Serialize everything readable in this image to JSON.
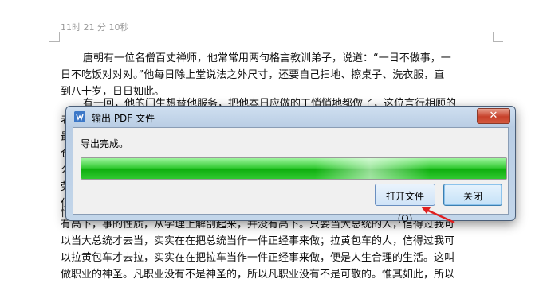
{
  "document": {
    "header_time": "11时 21 分 10秒",
    "paragraph1": [
      "唐朝有一位名僧百丈禅师，他常常用两句格言教训弟子，说道：“一日不做事，一",
      "日不吃饭对对对。”他每日除上堂说法之外尺寸，还要自己扫地、擦桌子、洗衣服，直",
      "到八十岁，日日如此。"
    ],
    "paragraph2_line1": "有一回，他的门生想替他服务，把他本日应做的工悄悄地都做了，这位言行相顾的",
    "paragraph2_frags": [
      "老",
      "最",
      "仓",
      "么",
      "劳",
      "但",
      "惜"
    ],
    "paragraph3": [
      "有高下，事的性质，从学理上解剖起来，并没有高下。只要当大总统的人，信得过我可",
      "以当大总统才去当，实实在在把总统当作一件正经事来做；拉黄包车的人，信得过我可",
      "以拉黄包车才去拉，实实在在把拉车当作一件正经事来做，便是人生合理的生活。这叫",
      "做职业的神圣。凡职业没有不是神圣的，所以凡职业没有不是可敬的。惟其如此，所以"
    ]
  },
  "dialog": {
    "title": "输出 PDF 文件",
    "close_symbol": "✕",
    "status": "导出完成。",
    "progress_percent": 100,
    "open_file_label": "打开文件(O)",
    "close_label": "关闭"
  },
  "colors": {
    "progress": "#22c022",
    "arrow": "#e02020",
    "title_bar": "#b9cde4",
    "close_button": "#c7402a"
  },
  "icons": {
    "app": "wps-writer-icon",
    "close": "close-icon",
    "arrow": "annotation-arrow-icon"
  }
}
